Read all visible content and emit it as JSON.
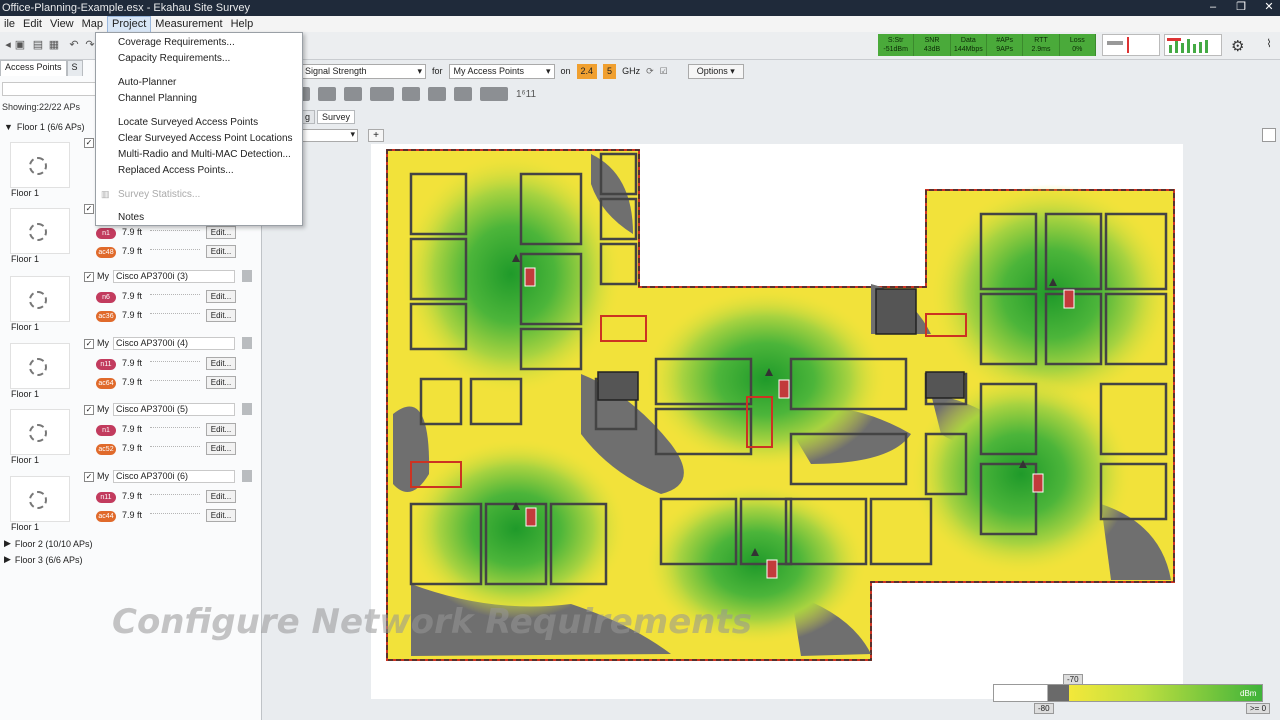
{
  "window": {
    "title": "Office-Planning-Example.esx - Ekahau Site Survey",
    "buttons": [
      "–",
      "❐",
      "✕"
    ]
  },
  "menubar": [
    "ile",
    "Edit",
    "View",
    "Map",
    "Project",
    "Measurement",
    "Help"
  ],
  "project_menu": {
    "items": [
      {
        "label": "Coverage Requirements...",
        "enabled": true
      },
      {
        "label": "Capacity Requirements...",
        "enabled": true
      },
      {
        "label": "Auto-Planner",
        "enabled": true
      },
      {
        "label": "Channel Planning",
        "enabled": true
      },
      {
        "label": "Locate Surveyed Access Points",
        "enabled": true
      },
      {
        "label": "Clear Surveyed Access Point Locations",
        "enabled": true
      },
      {
        "label": "Multi-Radio and Multi-MAC Detection...",
        "enabled": true
      },
      {
        "label": "Replaced Access Points...",
        "enabled": true
      },
      {
        "label": "Survey Statistics...",
        "enabled": false
      },
      {
        "label": "Notes",
        "enabled": true
      }
    ]
  },
  "status_strip": [
    {
      "label": "S:Str",
      "value": "-51dBm"
    },
    {
      "label": "SNR",
      "value": "43dB"
    },
    {
      "label": "Data",
      "value": "144Mbps"
    },
    {
      "label": "#APs",
      "value": "9APs"
    },
    {
      "label": "RTT",
      "value": "2.9ms"
    },
    {
      "label": "Loss",
      "value": "0%"
    }
  ],
  "visualization": {
    "metric": "Signal Strength",
    "for_label": "for",
    "target": "My Access Points",
    "on_label": "on",
    "bands": [
      "2.4",
      "5"
    ],
    "unit": "GHz",
    "options_label": "Options ▾"
  },
  "view_tabs": [
    "g",
    "Survey"
  ],
  "left_panel": {
    "tabs": [
      "Access Points",
      "S"
    ],
    "showing": "Showing:22/22 APs",
    "floor1": "Floor 1 (6/6 APs)",
    "access_points": [
      {
        "my": "My",
        "name": "",
        "floor": "Floor 1",
        "radios": []
      },
      {
        "my": "",
        "name": "",
        "floor": "Floor 1",
        "radios": [
          {
            "badge": "n1",
            "height": "7.9 ft"
          },
          {
            "badge": "ac48",
            "height": "7.9 ft"
          }
        ]
      },
      {
        "my": "My",
        "name": "Cisco AP3700i (3)",
        "floor": "Floor 1",
        "radios": [
          {
            "badge": "n6",
            "height": "7.9 ft"
          },
          {
            "badge": "ac36",
            "height": "7.9 ft"
          }
        ]
      },
      {
        "my": "My",
        "name": "Cisco AP3700i (4)",
        "floor": "Floor 1",
        "radios": [
          {
            "badge": "n11",
            "height": "7.9 ft"
          },
          {
            "badge": "ac64",
            "height": "7.9 ft"
          }
        ]
      },
      {
        "my": "My",
        "name": "Cisco AP3700i (5)",
        "floor": "Floor 1",
        "radios": [
          {
            "badge": "n1",
            "height": "7.9 ft"
          },
          {
            "badge": "ac52",
            "height": "7.9 ft"
          }
        ]
      },
      {
        "my": "My",
        "name": "Cisco AP3700i (6)",
        "floor": "Floor 1",
        "radios": [
          {
            "badge": "n11",
            "height": "7.9 ft"
          },
          {
            "badge": "ac44",
            "height": "7.9 ft"
          }
        ]
      }
    ],
    "edit_label": "Edit...",
    "floor2": "Floor 2 (10/10 APs)",
    "floor3": "Floor 3 (6/6 APs)"
  },
  "overlay_caption": "Configure Network Requirements",
  "legend": {
    "low": "-80",
    "mid": "-70",
    "high": ">= 0",
    "unit": "dBm"
  }
}
